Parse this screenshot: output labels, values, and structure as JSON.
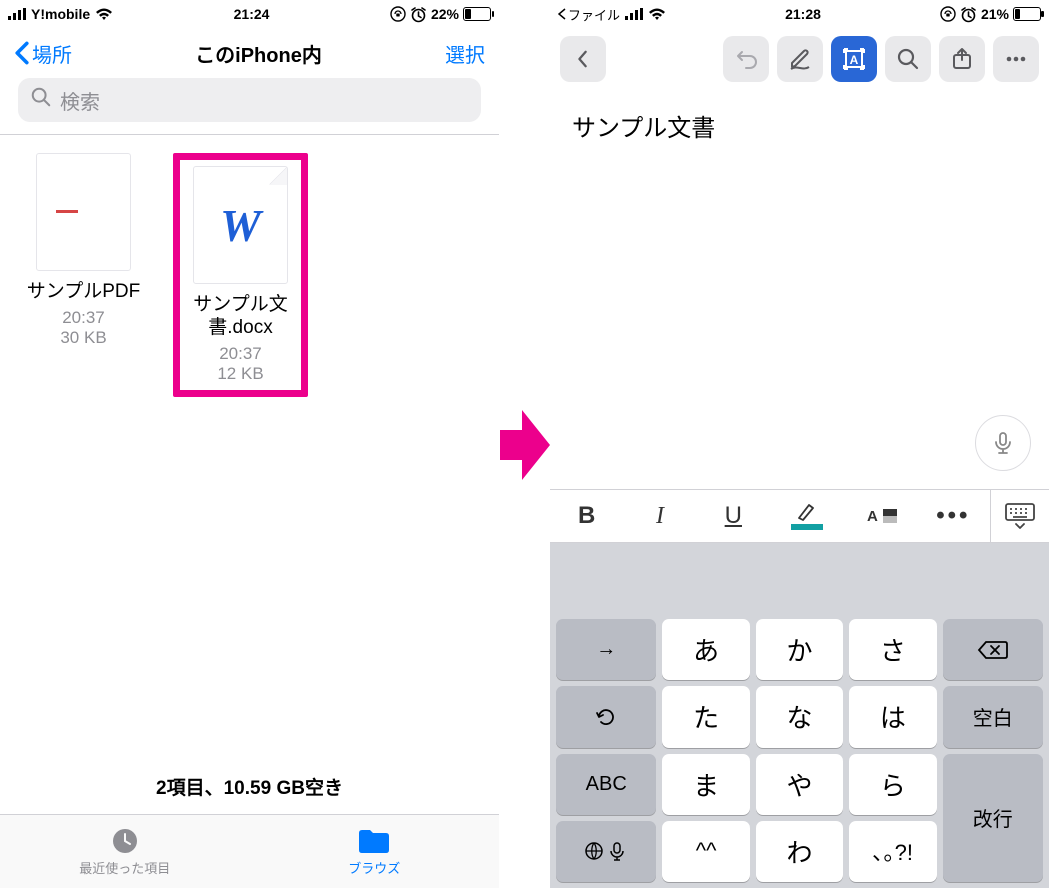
{
  "left": {
    "status": {
      "carrier": "Y!mobile",
      "time": "21:24",
      "battery_pct": "22%"
    },
    "nav": {
      "back": "場所",
      "title": "このiPhone内",
      "select": "選択"
    },
    "search_placeholder": "検索",
    "files": [
      {
        "name": "サンプルPDF",
        "time": "20:37",
        "size": "30 KB"
      },
      {
        "name": "サンプル文書.docx",
        "time": "20:37",
        "size": "12 KB"
      }
    ],
    "storage": "2項目、10.59 GB空き",
    "tabs": {
      "recent": "最近使った項目",
      "browse": "ブラウズ"
    }
  },
  "right": {
    "status": {
      "back_app": "ファイル",
      "time": "21:28",
      "battery_pct": "21%"
    },
    "document_text": "サンプル文書",
    "format": {
      "bold": "B",
      "italic": "I",
      "underline": "U",
      "more": "•••"
    },
    "keyboard": {
      "r1": [
        "→",
        "あ",
        "か",
        "さ",
        "⌫"
      ],
      "r2": [
        "↶",
        "た",
        "な",
        "は",
        "空白"
      ],
      "r3": [
        "ABC",
        "ま",
        "や",
        "ら",
        "改行"
      ],
      "r4": [
        "🌐 🎤",
        "^^",
        "わ",
        "､｡?!",
        ""
      ]
    }
  }
}
